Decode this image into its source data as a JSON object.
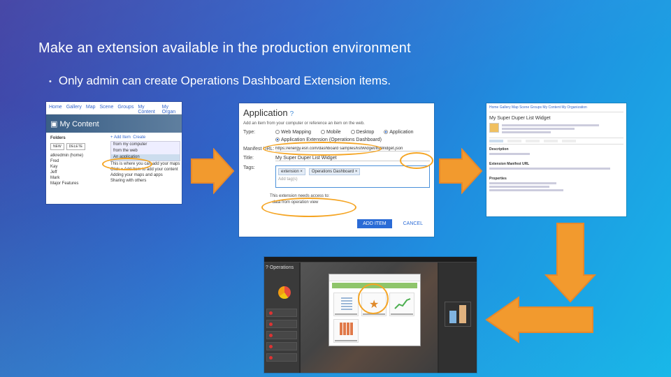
{
  "slide": {
    "title": "Make an extension available in the production environment",
    "bullet": "Only admin can create Operations Dashboard Extension items."
  },
  "my_content": {
    "nav": [
      "Home",
      "Gallery",
      "Map",
      "Scene",
      "Groups",
      "My Content",
      "My Organ"
    ],
    "banner": "My Content",
    "folders_heading": "Folders",
    "folder_buttons": [
      "NEW",
      "DELETE"
    ],
    "folders": [
      "atkredmin (home)",
      "Fred",
      "Kay",
      "Jeff",
      "Mark",
      "Major Features"
    ],
    "add_item_label": "+ Add Item",
    "create_label": "Create",
    "add_menu": [
      "from my computer",
      "from the web",
      "An application"
    ],
    "hint_lines": [
      "This is where you can add your maps",
      "Click + Add Item to add your content",
      "Adding your maps and apps",
      "Sharing with others"
    ]
  },
  "app_dialog": {
    "title": "Application",
    "help": "?",
    "subtitle": "Add an item from your computer or reference an item on the web.",
    "type_label": "Type:",
    "types": [
      "Web Mapping",
      "Mobile",
      "Desktop",
      "Application"
    ],
    "extension_option": "Application Extension (Operations Dashboard)",
    "manifest_label": "Manifest URL:",
    "manifest_value": "https://energy.esri.com/dashboard samples/listWidget/listWidget.json",
    "title_label": "Title:",
    "title_value": "My Super Duper List Widget",
    "tags_label": "Tags:",
    "tags": [
      "extension",
      "Operations Dashboard"
    ],
    "add_tags_placeholder": "Add tag(s)",
    "summary_lines": [
      "This extension needs access to:",
      "- data from operation view"
    ],
    "add_button": "ADD ITEM",
    "cancel_button": "CANCEL"
  },
  "item_page": {
    "nav": "Home  Gallery  Map  Scene  Groups  My Content  My Organization",
    "title": "My Super Duper List Widget",
    "tabs": [
      "",
      "",
      "",
      "",
      ""
    ],
    "sections": [
      "Description",
      "Extension Manifest URL",
      "Properties"
    ]
  },
  "ops_dashboard": {
    "brand": "Operations"
  },
  "colors": {
    "accent_orange": "#f5a524",
    "arrow_fill": "#f29a2e",
    "arrow_stroke": "#e8882a"
  }
}
